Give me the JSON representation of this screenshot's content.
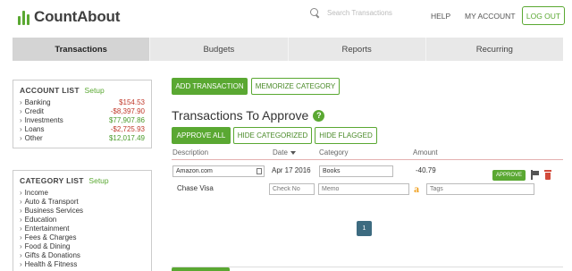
{
  "brand": {
    "name": "CountAbout",
    "accent": "#5aa832"
  },
  "header": {
    "search_placeholder": "Search Transactions",
    "help": "HELP",
    "my_account": "MY ACCOUNT",
    "logout": "LOG OUT"
  },
  "tabs": [
    {
      "label": "Transactions",
      "active": true
    },
    {
      "label": "Budgets",
      "active": false
    },
    {
      "label": "Reports",
      "active": false
    },
    {
      "label": "Recurring",
      "active": false
    }
  ],
  "account_list": {
    "title": "ACCOUNT LIST",
    "setup": "Setup",
    "items": [
      {
        "name": "Banking",
        "balance": "$154.53"
      },
      {
        "name": "Credit",
        "balance": "-$8,397.90"
      },
      {
        "name": "Investments",
        "balance": "$77,907.86"
      },
      {
        "name": "Loans",
        "balance": "-$2,725.93"
      },
      {
        "name": "Other",
        "balance": "$12,017.49"
      }
    ]
  },
  "category_list": {
    "title": "CATEGORY LIST",
    "setup": "Setup",
    "items": [
      "Income",
      "Auto & Transport",
      "Business Services",
      "Education",
      "Entertainment",
      "Fees & Charges",
      "Food & Dining",
      "Gifts & Donations",
      "Health & Fitness"
    ]
  },
  "main": {
    "add_transaction": "ADD TRANSACTION",
    "memorize_category": "MEMORIZE CATEGORY",
    "section_title": "Transactions To Approve",
    "help_icon": "?",
    "approve_all": "APPROVE ALL",
    "hide_categorized": "HIDE CATEGORIZED",
    "hide_flagged": "HIDE FLAGGED",
    "columns": {
      "description": "Description",
      "date": "Date",
      "category": "Category",
      "amount": "Amount"
    },
    "row": {
      "payee": "Amazon.com",
      "date": "Apr 17 2016",
      "category": "Books",
      "amount": "-40.79",
      "approve": "APPROVE",
      "account": "Chase Visa",
      "check_no_placeholder": "Check No",
      "memo_placeholder": "Memo",
      "tags_placeholder": "Tags"
    },
    "page": "1"
  }
}
